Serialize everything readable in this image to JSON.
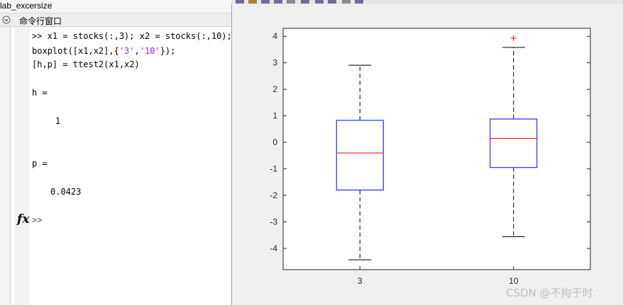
{
  "window": {
    "title": "lab_excersize"
  },
  "command_window": {
    "header": "命令行窗口",
    "lines": [
      ">> x1 = stocks(:,3); x2 = stocks(:,10);",
      "boxplot([x1,x2],{'3','10'});",
      "[h,p] = ttest2(x1,x2)",
      "h =",
      "1",
      "p =",
      "0.0423"
    ],
    "prompt": ">>",
    "fx_label": "fx"
  },
  "figure": {
    "watermark": "CSDN @不拘于时."
  },
  "chart_data": {
    "type": "box",
    "categories": [
      "3",
      "10"
    ],
    "series": [
      {
        "category": "3",
        "whisker_low": -4.43,
        "q1": -1.8,
        "median": -0.4,
        "q3": 0.83,
        "whisker_high": 2.91,
        "outliers": []
      },
      {
        "category": "10",
        "whisker_low": -3.56,
        "q1": -0.95,
        "median": 0.15,
        "q3": 0.88,
        "whisker_high": 3.58,
        "outliers": [
          3.93
        ]
      }
    ],
    "ylim": [
      -4.8,
      4.3
    ],
    "yticks": [
      -4,
      -3,
      -2,
      -1,
      0,
      1,
      2,
      3,
      4
    ],
    "xlabel": "",
    "ylabel": "",
    "colors": {
      "box": "#0000ff",
      "median": "#ff0000",
      "whisker": "#000000",
      "outlier": "#ff0000"
    }
  }
}
